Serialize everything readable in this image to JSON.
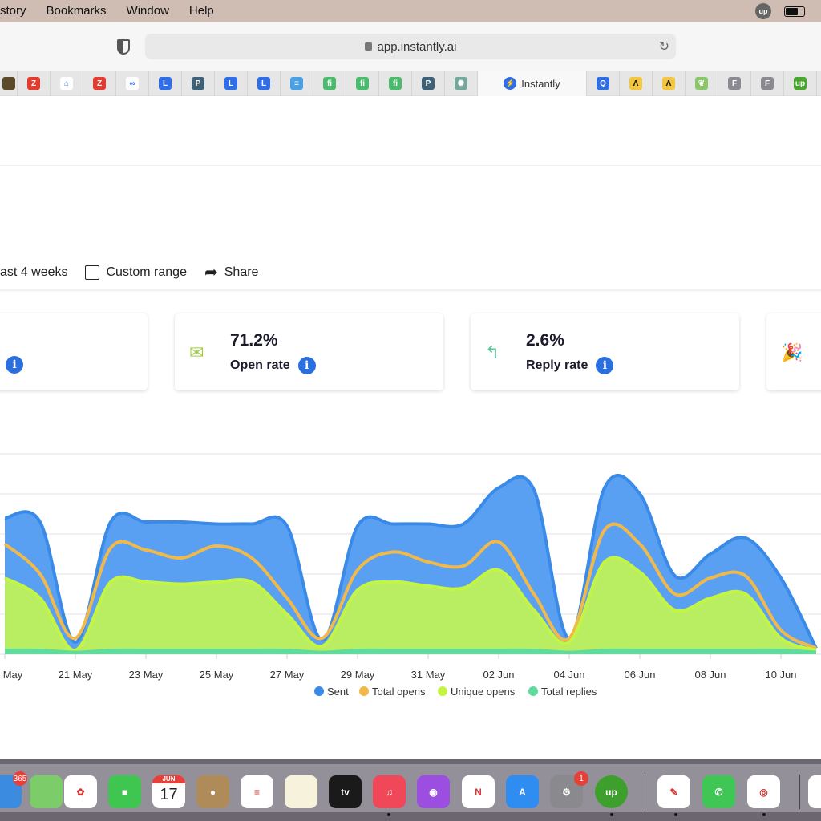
{
  "menubar": {
    "items": [
      "story",
      "Bookmarks",
      "Window",
      "Help"
    ]
  },
  "browser": {
    "url": "app.instantly.ai",
    "active_tab": "Instantly",
    "tabs": [
      {
        "icon": "lion-icon",
        "color": "#5a4a2a",
        "g": ""
      },
      {
        "icon": "zoho-z-icon",
        "color": "#e23c30",
        "g": "Z"
      },
      {
        "icon": "home-icon",
        "color": "#ffffff",
        "g": "⌂"
      },
      {
        "icon": "zoho-z-icon",
        "color": "#e23c30",
        "g": "Z"
      },
      {
        "icon": "link-icon",
        "color": "#ffffff",
        "g": "∞"
      },
      {
        "icon": "lemlist-icon",
        "color": "#2f6ee8",
        "g": "L"
      },
      {
        "icon": "pipe-icon",
        "color": "#3f6177",
        "g": "P"
      },
      {
        "icon": "lemlist-icon",
        "color": "#2f6ee8",
        "g": "L"
      },
      {
        "icon": "lemlist-icon",
        "color": "#2f6ee8",
        "g": "L"
      },
      {
        "icon": "list-icon",
        "color": "#4aa0e0",
        "g": "≡"
      },
      {
        "icon": "fi-icon",
        "color": "#4cba6c",
        "g": "fi"
      },
      {
        "icon": "fi-icon",
        "color": "#4cba6c",
        "g": "fi"
      },
      {
        "icon": "fi-icon",
        "color": "#4cba6c",
        "g": "fi"
      },
      {
        "icon": "pipe-icon",
        "color": "#3f6177",
        "g": "P"
      },
      {
        "icon": "chatgpt-icon",
        "color": "#74a89a",
        "g": "✺"
      }
    ],
    "tabs_right": [
      {
        "icon": "search-q-icon",
        "color": "#2f6ee8",
        "g": "Q"
      },
      {
        "icon": "apollo-icon",
        "color": "#f3c63f",
        "g": "Λ"
      },
      {
        "icon": "apollo-icon",
        "color": "#f3c63f",
        "g": "Λ"
      },
      {
        "icon": "wheat-icon",
        "color": "#8cc66a",
        "g": "❦"
      },
      {
        "icon": "f-icon",
        "color": "#8a8a90",
        "g": "F"
      },
      {
        "icon": "f-icon",
        "color": "#8a8a90",
        "g": "F"
      },
      {
        "icon": "upwork-icon",
        "color": "#4aa52e",
        "g": "up"
      }
    ]
  },
  "filters": {
    "range": "ast 4 weeks",
    "custom": "Custom range",
    "share": "Share"
  },
  "cards": [
    {
      "value": "",
      "label": ""
    },
    {
      "value": "71.2%",
      "label": "Open rate",
      "icon": "envelope-open-icon",
      "color": "#9fcf3e"
    },
    {
      "value": "2.6%",
      "label": "Reply rate",
      "icon": "reply-icon",
      "color": "#5fc79a"
    },
    {
      "icon": "party-popper-icon",
      "color": "#ee7a34"
    }
  ],
  "chart_data": {
    "type": "area",
    "ylim": [
      0,
      100
    ],
    "grid": true,
    "legend": "bottom",
    "x": [
      "19 May",
      "20 May",
      "21 May",
      "22 May",
      "23 May",
      "24 May",
      "25 May",
      "26 May",
      "27 May",
      "28 May",
      "29 May",
      "30 May",
      "31 May",
      "01 Jun",
      "02 Jun",
      "03 Jun",
      "04 Jun",
      "05 Jun",
      "06 Jun",
      "07 Jun",
      "08 Jun",
      "09 Jun",
      "10 Jun",
      "11 Jun"
    ],
    "tick_labels": [
      "May",
      "21 May",
      "23 May",
      "25 May",
      "27 May",
      "29 May",
      "31 May",
      "02 Jun",
      "04 Jun",
      "06 Jun",
      "08 Jun",
      "10 Jun"
    ],
    "series": [
      {
        "name": "Sent",
        "color": "#3a8ae8",
        "values": [
          68,
          66,
          6,
          66,
          66,
          66,
          65,
          65,
          64,
          7,
          64,
          65,
          65,
          65,
          83,
          82,
          8,
          83,
          80,
          39,
          50,
          58,
          38,
          3
        ]
      },
      {
        "name": "Total opens",
        "color": "#f0b94a",
        "values": [
          55,
          40,
          8,
          53,
          52,
          48,
          54,
          48,
          28,
          8,
          42,
          51,
          46,
          44,
          56,
          30,
          8,
          62,
          55,
          30,
          38,
          39,
          12,
          3
        ]
      },
      {
        "name": "Unique opens",
        "color": "#c5f544",
        "values": [
          38,
          28,
          2,
          36,
          36,
          35,
          36,
          36,
          20,
          4,
          32,
          36,
          34,
          33,
          42,
          22,
          6,
          46,
          41,
          22,
          28,
          30,
          8,
          2
        ]
      },
      {
        "name": "Total replies",
        "color": "#5fdc9c",
        "values": [
          2,
          2,
          1,
          2,
          2,
          2,
          2,
          2,
          2,
          1,
          2,
          2,
          2,
          2,
          2,
          2,
          1,
          2,
          2,
          2,
          2,
          2,
          2,
          1
        ]
      }
    ]
  },
  "dock": {
    "apps": [
      {
        "name": "office365",
        "color": "#3b8be0",
        "g": "",
        "badge": "365"
      },
      {
        "name": "maps",
        "color": "#7dcc6a",
        "g": ""
      },
      {
        "name": "photos",
        "color": "#ffffff",
        "g": "✿"
      },
      {
        "name": "facetime",
        "color": "#3fc650",
        "g": "■"
      },
      {
        "name": "calendar",
        "color": "#ffffff",
        "g": "17",
        "sub": "JUN"
      },
      {
        "name": "contacts",
        "color": "#b08b5a",
        "g": "●"
      },
      {
        "name": "reminders",
        "color": "#ffffff",
        "g": "≡"
      },
      {
        "name": "notes",
        "color": "#f7f2dc",
        "g": ""
      },
      {
        "name": "apple-tv",
        "color": "#1a1a1a",
        "g": "tv"
      },
      {
        "name": "music",
        "color": "#f04858",
        "g": "♫"
      },
      {
        "name": "podcasts",
        "color": "#9b4ee0",
        "g": "◉"
      },
      {
        "name": "news",
        "color": "#ffffff",
        "g": "N"
      },
      {
        "name": "app-store",
        "color": "#2f8cf0",
        "g": "A"
      },
      {
        "name": "system-preferences",
        "color": "#8a8a8e",
        "g": "⚙",
        "badge": "1"
      },
      {
        "name": "upwork",
        "color": "#3ea02c",
        "g": "up"
      },
      {
        "name": "textedit",
        "color": "#ffffff",
        "g": "✎"
      },
      {
        "name": "whatsapp",
        "color": "#3fc655",
        "g": "✆"
      },
      {
        "name": "chrome",
        "color": "#ffffff",
        "g": "◎"
      },
      {
        "name": "document",
        "color": "#ffffff",
        "g": ""
      }
    ]
  }
}
